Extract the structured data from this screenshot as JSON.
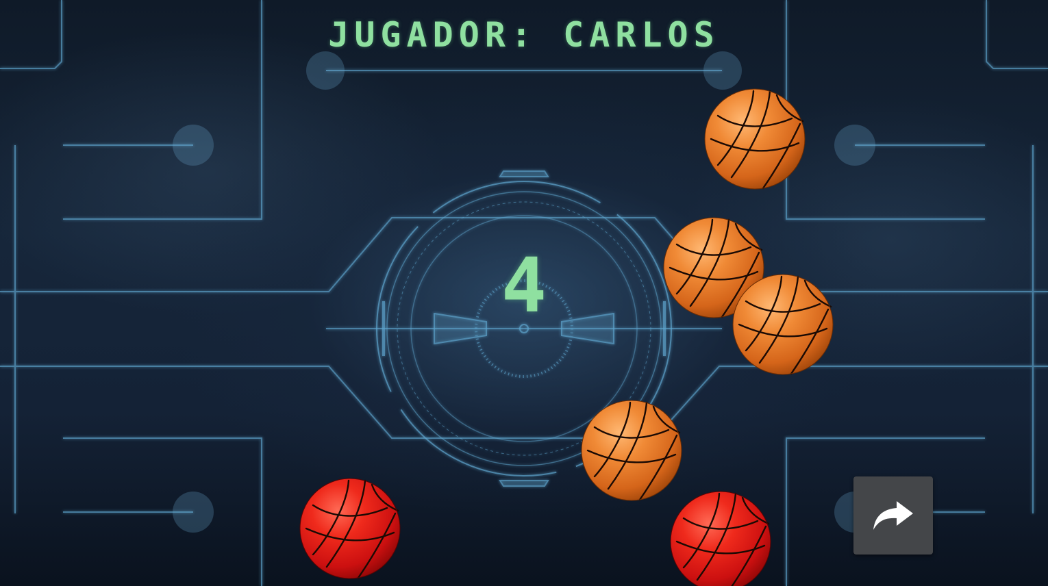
{
  "header": {
    "player_label": "JUGADOR: CARLOS"
  },
  "countdown": {
    "value": "4"
  },
  "balls": [
    {
      "color": "orange"
    },
    {
      "color": "orange"
    },
    {
      "color": "orange"
    },
    {
      "color": "orange"
    },
    {
      "color": "red"
    },
    {
      "color": "red"
    }
  ],
  "controls": {
    "next_button_icon": "share-arrow-icon"
  },
  "colors": {
    "text_accent": "#8fe0a0",
    "ball_orange": "#e8741c",
    "ball_red": "#d81414",
    "circuit_line": "#5fa6cf",
    "button_bg": "#444649"
  }
}
